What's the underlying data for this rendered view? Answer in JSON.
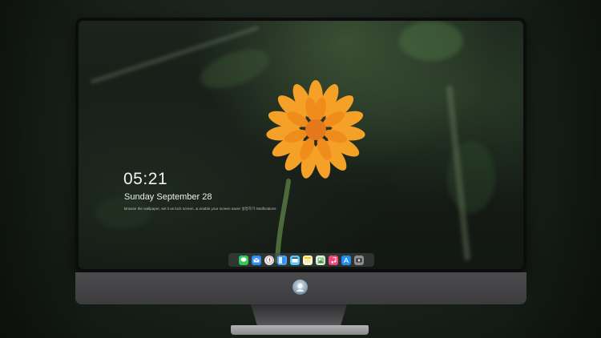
{
  "lockscreen": {
    "time": "05:21",
    "date": "Sunday September  28",
    "caption": "Browse the wallpaper, set it as lock screen, & enable your screen saver  설정하기   Notifications"
  },
  "dock": {
    "icons": [
      "messages-icon",
      "mail-icon",
      "safari-icon",
      "finder-icon",
      "clapperboard-icon",
      "notes-icon",
      "photos-icon",
      "music-icon",
      "app-store-icon",
      "camera-icon"
    ]
  },
  "colors": {
    "flower": "#f39a1e",
    "flower_center": "#e4781a",
    "monitor_chin": "#444447"
  }
}
